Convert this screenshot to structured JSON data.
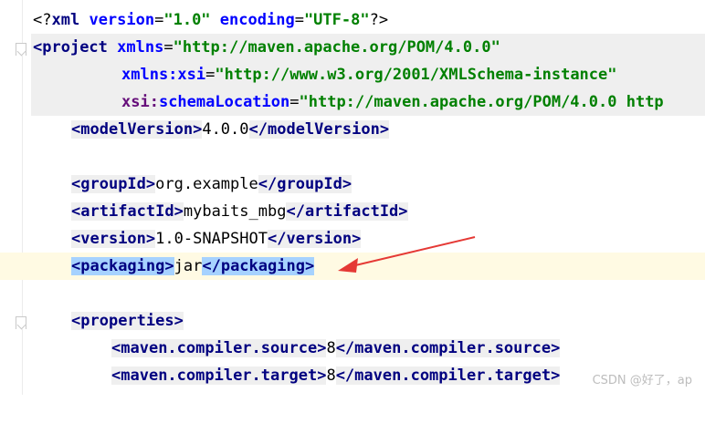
{
  "editor": {
    "lines": {
      "l1": {
        "open": "<?",
        "name": "xml",
        "a1": "version",
        "eq": "=",
        "v1": "\"1.0\"",
        "a2": "encoding",
        "v2": "\"UTF-8\"",
        "close": "?>"
      },
      "l2": {
        "open": "<",
        "tag": "project",
        "attr": "xmlns",
        "v": "\"http://maven.apache.org/POM/4.0.0\""
      },
      "l3": {
        "ns": "xmlns:",
        "attr": "xsi",
        "v": "\"http://www.w3.org/2001/XMLSchema-instance\""
      },
      "l4": {
        "ns": "xsi:",
        "attr": "schemaLocation",
        "v": "\"http://maven.apache.org/POM/4.0.0 http"
      },
      "l5": {
        "tag": "modelVersion",
        "text": "4.0.0"
      },
      "l7": {
        "tag": "groupId",
        "text": "org.example"
      },
      "l8": {
        "tag": "artifactId",
        "text": "mybaits_mbg"
      },
      "l9": {
        "tag": "version",
        "text": "1.0-SNAPSHOT"
      },
      "l10": {
        "tag": "packaging",
        "text_before": "jar",
        "text_after": ""
      },
      "l12": {
        "tag": "properties"
      },
      "l13": {
        "tag": "maven.compiler.source",
        "text": "8"
      },
      "l14": {
        "tag": "maven.compiler.target",
        "text": "8"
      }
    }
  },
  "watermark": "CSDN @好了，ap",
  "colors": {
    "tag": "#000080",
    "attr": "#0000ff",
    "value": "#008000",
    "selection": "#a6d2ff",
    "arrow": "#e53935"
  }
}
